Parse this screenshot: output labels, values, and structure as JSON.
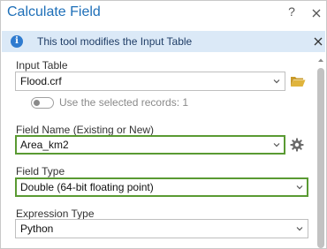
{
  "window": {
    "title": "Calculate Field",
    "help_label": "?"
  },
  "infobar": {
    "message": "This tool modifies the Input Table"
  },
  "input_table": {
    "label": "Input Table",
    "value": "Flood.crf"
  },
  "selected_records": {
    "label": "Use the selected records: 1",
    "enabled": false
  },
  "field_name": {
    "label": "Field Name (Existing or New)",
    "value": "Area_km2"
  },
  "field_type": {
    "label": "Field Type",
    "value": "Double (64-bit floating point)"
  },
  "expression_type": {
    "label": "Expression Type",
    "value": "Python"
  },
  "colors": {
    "title_blue": "#1e6fb8",
    "info_bg": "#dbe9f7",
    "highlight_green": "#5a9a33",
    "folder_yellow": "#e0b43c"
  },
  "icons": [
    "close-icon",
    "info-icon",
    "chevron-down-icon",
    "folder-open-icon",
    "gear-icon"
  ]
}
